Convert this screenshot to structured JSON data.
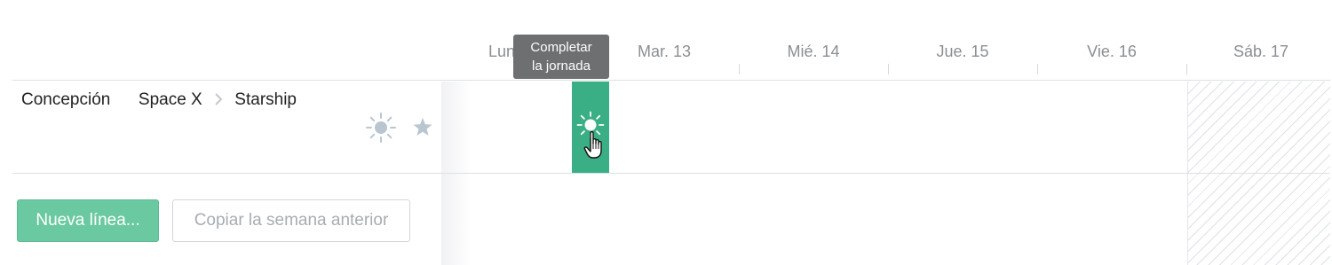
{
  "days": [
    {
      "label": "Lun. 12"
    },
    {
      "label": "Mar. 13"
    },
    {
      "label": "Mié. 14"
    },
    {
      "label": "Jue. 15"
    },
    {
      "label": "Vie. 16"
    },
    {
      "label": "Sáb. 17"
    }
  ],
  "tooltip": {
    "line1": "Completar",
    "line2": "la jornada"
  },
  "row": {
    "client": "Concepción",
    "project": "Space X",
    "task": "Starship",
    "separator_icon": "chevron-right-icon"
  },
  "icons": {
    "full_day": "sun-icon",
    "favorite": "star-icon",
    "pointer": "hand-pointer-icon"
  },
  "buttons": {
    "new_line": "Nueva línea...",
    "copy_week": "Copiar la semana anterior"
  },
  "colors": {
    "accent": "#3aae84",
    "accent_button": "#6bc9a1",
    "tooltip_bg": "#6d6f71",
    "muted_icon": "#b9c6d0"
  }
}
